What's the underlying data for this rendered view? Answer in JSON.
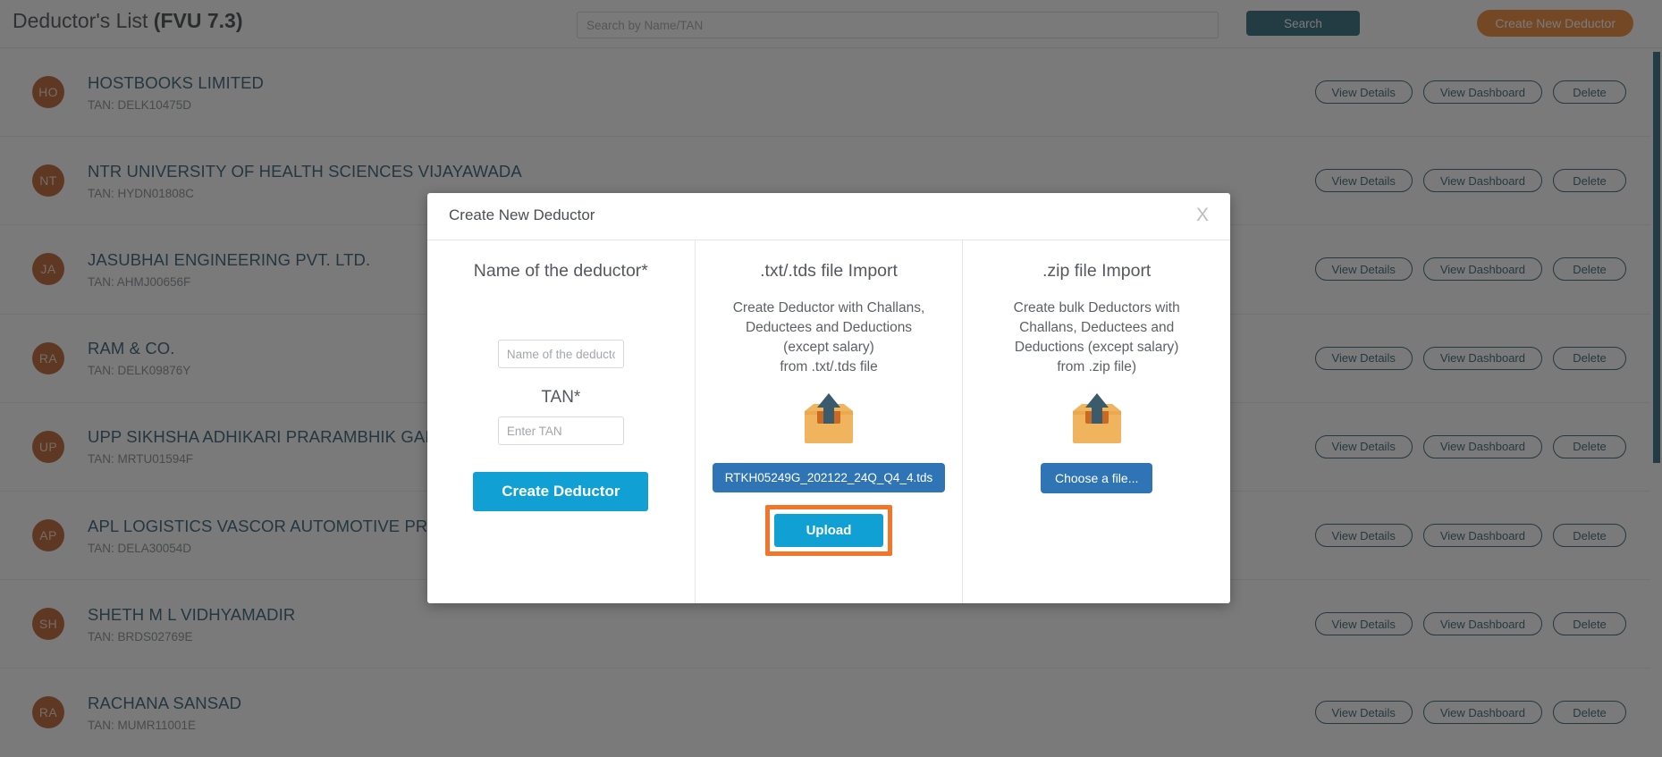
{
  "header": {
    "title_main": "Deductor's List",
    "title_version": "(FVU 7.3)",
    "search_placeholder": "Search by Name/TAN",
    "search_value": "",
    "search_button": "Search",
    "create_button": "Create New Deductor"
  },
  "row_actions": {
    "view_details": "View Details",
    "view_dashboard": "View Dashboard",
    "delete": "Delete"
  },
  "deductors": [
    {
      "initials": "HO",
      "name": "HOSTBOOKS LIMITED",
      "tan": "TAN: DELK10475D"
    },
    {
      "initials": "NT",
      "name": "NTR UNIVERSITY OF HEALTH SCIENCES VIJAYAWADA",
      "tan": "TAN: HYDN01808C"
    },
    {
      "initials": "JA",
      "name": "JASUBHAI ENGINEERING PVT. LTD.",
      "tan": "TAN: AHMJ00656F"
    },
    {
      "initials": "RA",
      "name": "RAM & CO.",
      "tan": "TAN: DELK09876Y"
    },
    {
      "initials": "UP",
      "name": "UPP SIKHSHA ADHIKARI PRARAMBHIK GAIRSAIN",
      "tan": "TAN: MRTU01594F"
    },
    {
      "initials": "AP",
      "name": "APL LOGISTICS VASCOR AUTOMOTIVE PRIVATE LIMITED",
      "tan": "TAN: DELA30054D"
    },
    {
      "initials": "SH",
      "name": "SHETH M L VIDHYAMADIR",
      "tan": "TAN: BRDS02769E"
    },
    {
      "initials": "RA",
      "name": "RACHANA SANSAD",
      "tan": "TAN: MUMR11001E"
    }
  ],
  "modal": {
    "title": "Create New Deductor",
    "close_label": "X",
    "left": {
      "heading": "Name of the deductor*",
      "name_placeholder": "Name of the deductor",
      "name_value": "",
      "tan_label": "TAN*",
      "tan_placeholder": "Enter TAN",
      "tan_value": "",
      "submit_label": "Create Deductor"
    },
    "middle": {
      "heading": ".txt/.tds file Import",
      "description": "Create Deductor with Challans, Deductees and Deductions (except salary) from .txt/.tds file",
      "selected_file": "RTKH05249G_202122_24Q_Q4_4.tds",
      "upload_label": "Upload"
    },
    "right": {
      "heading": ".zip file Import",
      "description": "Create bulk Deductors with Challans, Deductees and Deductions (except salary) from .zip file)",
      "choose_label": "Choose a file..."
    }
  },
  "colors": {
    "accent_blue": "#11a0d4",
    "teal": "#1c5a6e",
    "orange": "#f07c20",
    "highlight_orange": "#f2762a",
    "avatar": "#b5521b",
    "file_button_blue": "#2f74b5"
  }
}
